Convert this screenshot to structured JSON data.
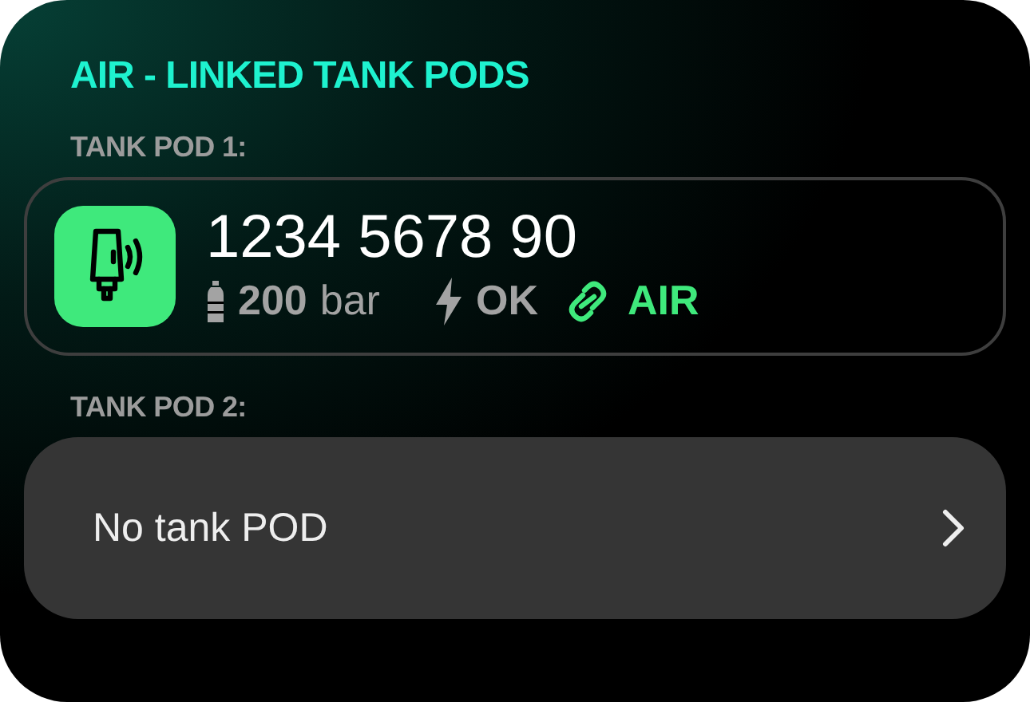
{
  "title": "AIR - LINKED TANK PODS",
  "pods": [
    {
      "label": "TANK POD 1:",
      "kind": "linked",
      "serial": "1234 5678 90",
      "pressure": "200",
      "unit": "bar",
      "status": "OK",
      "link": "AIR"
    },
    {
      "label": "TANK POD 2:",
      "kind": "empty",
      "text": "No tank POD"
    }
  ]
}
